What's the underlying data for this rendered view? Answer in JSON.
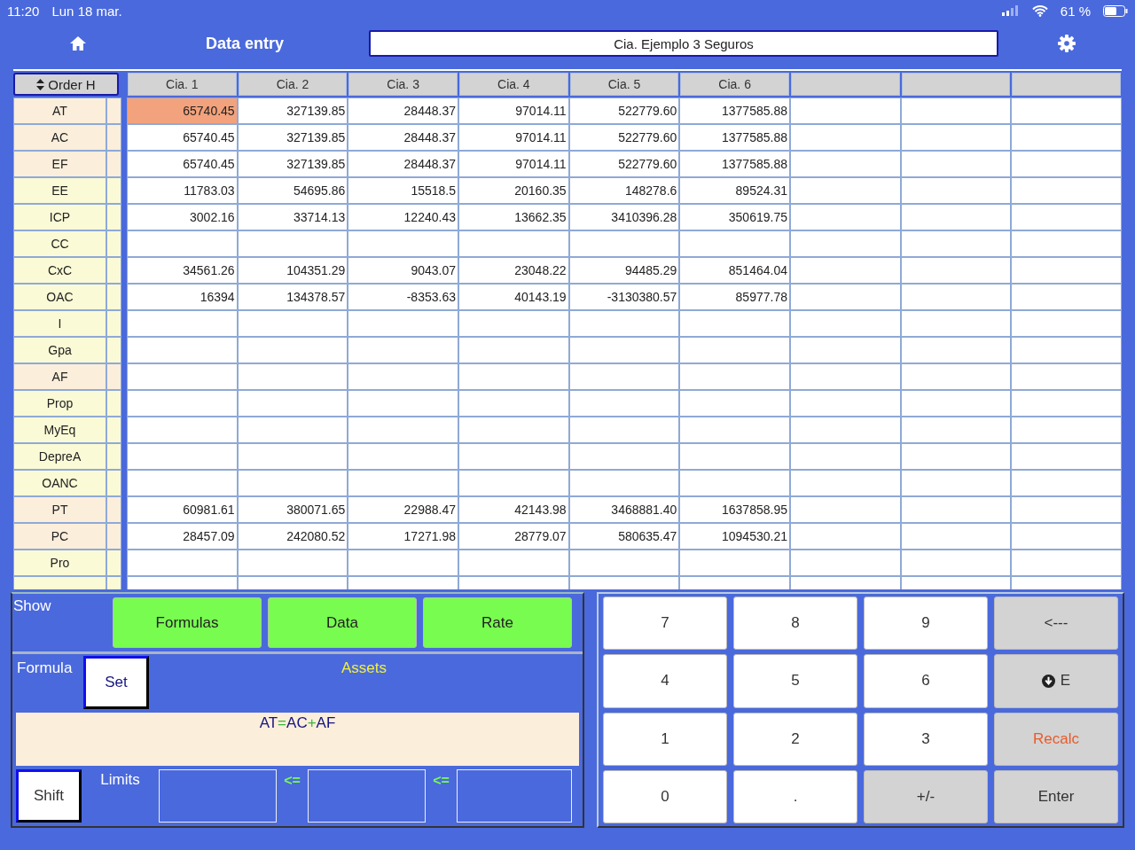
{
  "status_bar": {
    "time": "11:20",
    "date": "Lun 18 mar.",
    "battery": "61 %"
  },
  "header": {
    "title": "Data entry",
    "company": "Cia. Ejemplo 3 Seguros"
  },
  "table": {
    "order_button": "Order H",
    "columns": [
      "Cia. 1",
      "Cia. 2",
      "Cia. 3",
      "Cia. 4",
      "Cia. 5",
      "Cia. 6"
    ],
    "rows": [
      {
        "label": "AT",
        "kind": "total",
        "cells": [
          {
            "value": "65740.45",
            "selected": true
          },
          {
            "value": "327139.85",
            "selected": false
          },
          {
            "value": "28448.37",
            "selected": false
          },
          {
            "value": "97014.11",
            "selected": false
          },
          {
            "value": "522779.60",
            "selected": false
          },
          {
            "value": "1377585.88",
            "selected": false
          }
        ]
      },
      {
        "label": "AC",
        "kind": "total",
        "cells": [
          {
            "value": "65740.45",
            "selected": false
          },
          {
            "value": "327139.85",
            "selected": false
          },
          {
            "value": "28448.37",
            "selected": false
          },
          {
            "value": "97014.11",
            "selected": false
          },
          {
            "value": "522779.60",
            "selected": false
          },
          {
            "value": "1377585.88",
            "selected": false
          }
        ]
      },
      {
        "label": "EF",
        "kind": "total",
        "cells": [
          {
            "value": "65740.45",
            "selected": false
          },
          {
            "value": "327139.85",
            "selected": false
          },
          {
            "value": "28448.37",
            "selected": false
          },
          {
            "value": "97014.11",
            "selected": false
          },
          {
            "value": "522779.60",
            "selected": false
          },
          {
            "value": "1377585.88",
            "selected": false
          }
        ]
      },
      {
        "label": "EE",
        "kind": "item",
        "cells": [
          {
            "value": "11783.03",
            "selected": false
          },
          {
            "value": "54695.86",
            "selected": false
          },
          {
            "value": "15518.5",
            "selected": false
          },
          {
            "value": "20160.35",
            "selected": false
          },
          {
            "value": "148278.6",
            "selected": false
          },
          {
            "value": "89524.31",
            "selected": false
          }
        ]
      },
      {
        "label": "ICP",
        "kind": "item",
        "cells": [
          {
            "value": "3002.16",
            "selected": false
          },
          {
            "value": "33714.13",
            "selected": false
          },
          {
            "value": "12240.43",
            "selected": false
          },
          {
            "value": "13662.35",
            "selected": false
          },
          {
            "value": "3410396.28",
            "selected": false
          },
          {
            "value": "350619.75",
            "selected": false
          }
        ]
      },
      {
        "label": "CC",
        "kind": "item",
        "cells": []
      },
      {
        "label": "CxC",
        "kind": "item",
        "cells": [
          {
            "value": "34561.26",
            "selected": false
          },
          {
            "value": "104351.29",
            "selected": false
          },
          {
            "value": "9043.07",
            "selected": false
          },
          {
            "value": "23048.22",
            "selected": false
          },
          {
            "value": "94485.29",
            "selected": false
          },
          {
            "value": "851464.04",
            "selected": false
          }
        ]
      },
      {
        "label": "OAC",
        "kind": "item",
        "cells": [
          {
            "value": "16394",
            "selected": false
          },
          {
            "value": "134378.57",
            "selected": false
          },
          {
            "value": "-8353.63",
            "selected": false
          },
          {
            "value": "40143.19",
            "selected": false
          },
          {
            "value": "-3130380.57",
            "selected": false
          },
          {
            "value": "85977.78",
            "selected": false
          }
        ]
      },
      {
        "label": "I",
        "kind": "item",
        "cells": []
      },
      {
        "label": "Gpa",
        "kind": "item",
        "cells": []
      },
      {
        "label": "AF",
        "kind": "total",
        "cells": []
      },
      {
        "label": "Prop",
        "kind": "item",
        "cells": []
      },
      {
        "label": "MyEq",
        "kind": "item",
        "cells": []
      },
      {
        "label": "DepreA",
        "kind": "item",
        "cells": []
      },
      {
        "label": "OANC",
        "kind": "item",
        "cells": []
      },
      {
        "label": "PT",
        "kind": "total",
        "cells": [
          {
            "value": "60981.61",
            "selected": false
          },
          {
            "value": "380071.65",
            "selected": false
          },
          {
            "value": "22988.47",
            "selected": false
          },
          {
            "value": "42143.98",
            "selected": false
          },
          {
            "value": "3468881.40",
            "selected": false
          },
          {
            "value": "1637858.95",
            "selected": false
          }
        ]
      },
      {
        "label": "PC",
        "kind": "total",
        "cells": [
          {
            "value": "28457.09",
            "selected": false
          },
          {
            "value": "242080.52",
            "selected": false
          },
          {
            "value": "17271.98",
            "selected": false
          },
          {
            "value": "28779.07",
            "selected": false
          },
          {
            "value": "580635.47",
            "selected": false
          },
          {
            "value": "1094530.21",
            "selected": false
          }
        ]
      },
      {
        "label": "Pro",
        "kind": "item",
        "cells": []
      }
    ]
  },
  "show": {
    "label": "Show",
    "buttons": [
      "Formulas",
      "Data",
      "Rate"
    ]
  },
  "formula": {
    "label": "Formula",
    "set_button": "Set",
    "name": "Assets",
    "tokens": [
      {
        "text": "AT",
        "kind": "operand"
      },
      {
        "text": "=",
        "kind": "operator"
      },
      {
        "text": "AC",
        "kind": "operand"
      },
      {
        "text": "+",
        "kind": "operator"
      },
      {
        "text": "AF",
        "kind": "operand"
      }
    ]
  },
  "limits": {
    "shift_button": "Shift",
    "label": "Limits",
    "separators": [
      "<=",
      "<="
    ]
  },
  "keypad": [
    {
      "label": "7",
      "kind": "digit"
    },
    {
      "label": "8",
      "kind": "digit"
    },
    {
      "label": "9",
      "kind": "digit"
    },
    {
      "label": "<---",
      "kind": "action"
    },
    {
      "label": "4",
      "kind": "digit"
    },
    {
      "label": "5",
      "kind": "digit"
    },
    {
      "label": "6",
      "kind": "digit"
    },
    {
      "label": "E",
      "kind": "exponent"
    },
    {
      "label": "1",
      "kind": "digit"
    },
    {
      "label": "2",
      "kind": "digit"
    },
    {
      "label": "3",
      "kind": "digit"
    },
    {
      "label": "Recalc",
      "kind": "alert"
    },
    {
      "label": "0",
      "kind": "digit"
    },
    {
      "label": ".",
      "kind": "digit"
    },
    {
      "label": "+/-",
      "kind": "action"
    },
    {
      "label": "Enter",
      "kind": "action"
    }
  ]
}
